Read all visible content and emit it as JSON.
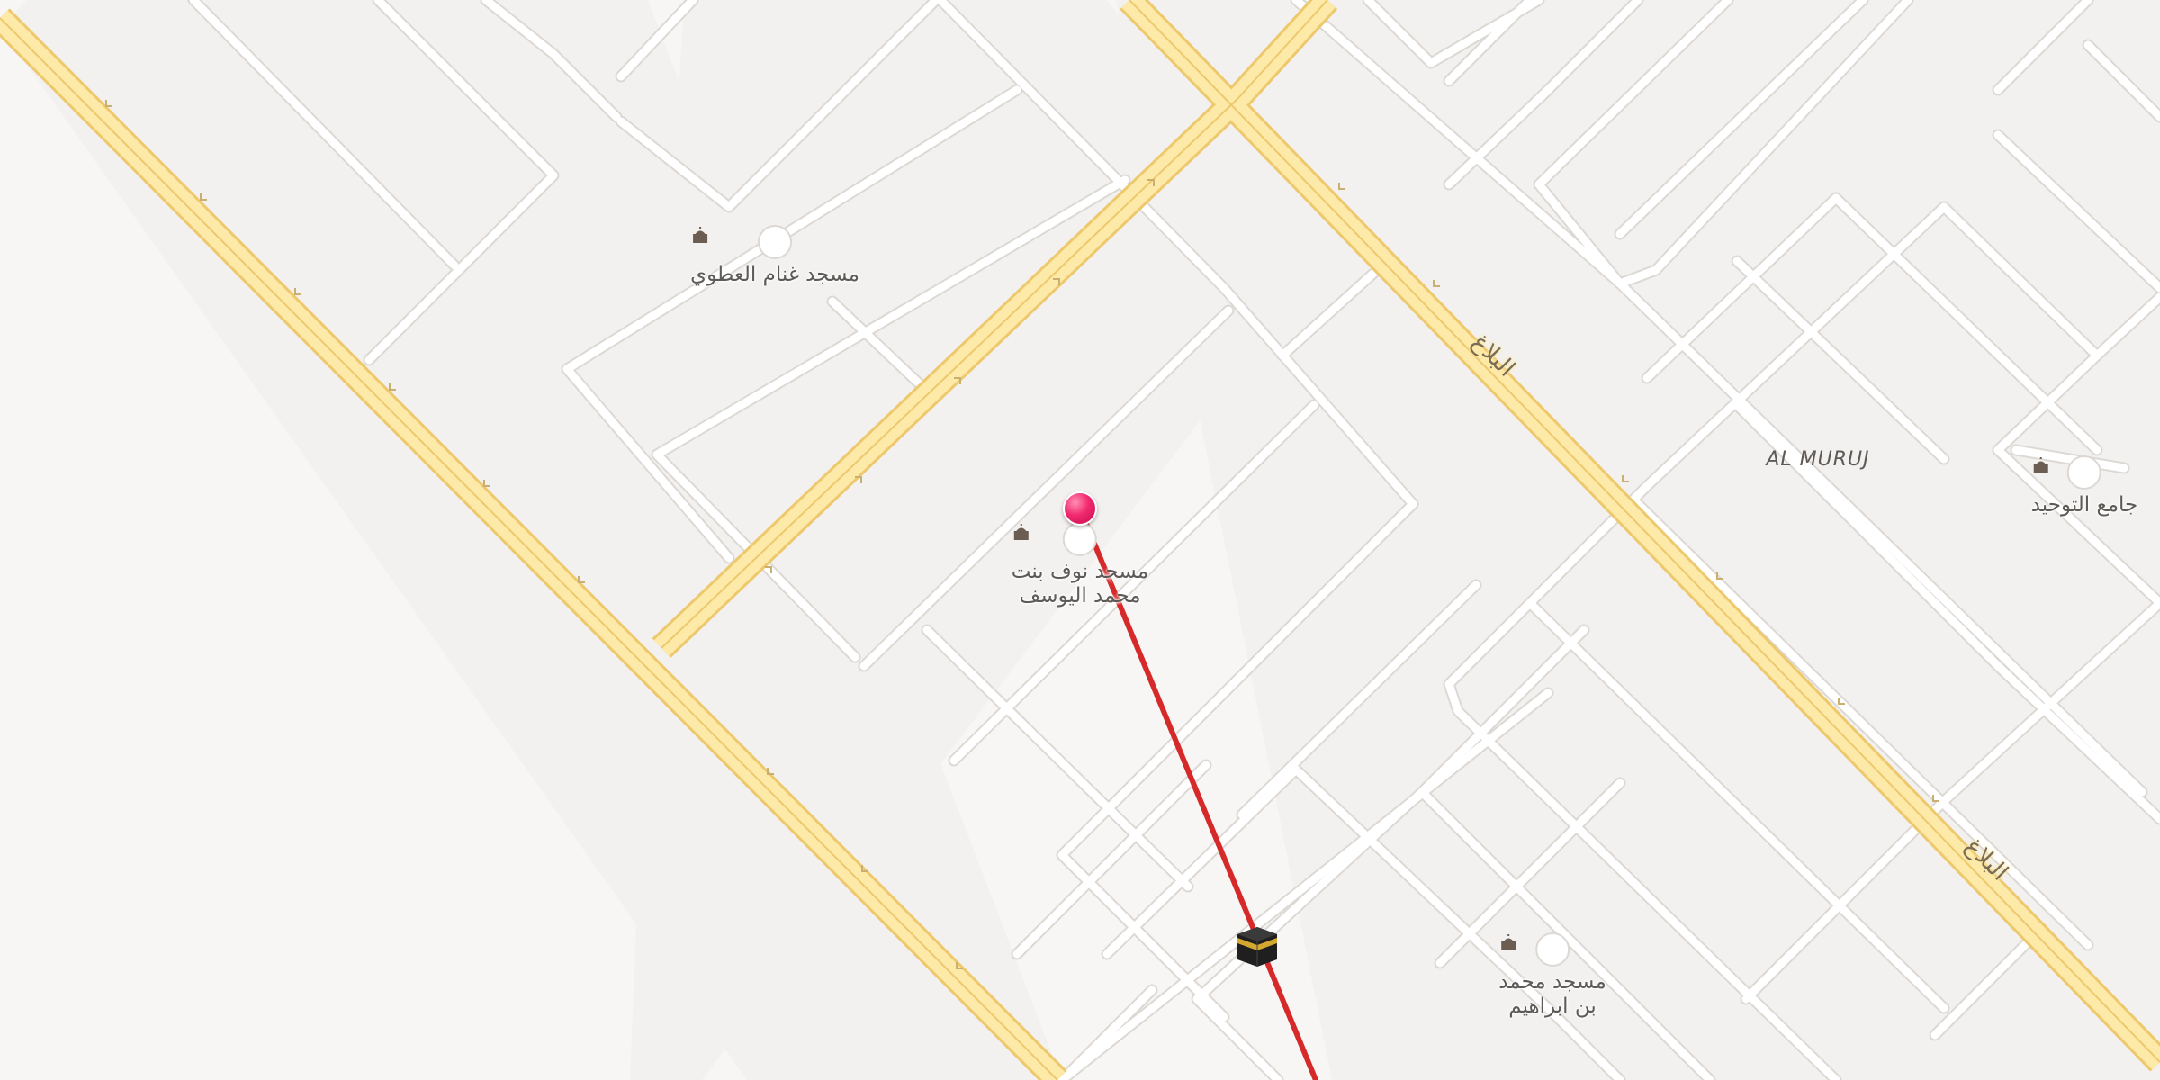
{
  "area_label": "AL MURUJ",
  "road_labels": [
    "البلاغ",
    "البلاغ"
  ],
  "pois": [
    {
      "id": "ghannam",
      "name_lines": [
        "مسجد غنام العطوي"
      ],
      "icon": "mosque-icon"
    },
    {
      "id": "nouf",
      "name_lines": [
        "مسجد نوف بنت",
        "محمد اليوسف"
      ],
      "icon": "mosque-icon"
    },
    {
      "id": "tawheed",
      "name_lines": [
        "جامع التوحيد"
      ],
      "icon": "mosque-icon"
    },
    {
      "id": "muhammad",
      "name_lines": [
        "مسجد محمد",
        "بن ابراهيم"
      ],
      "icon": "mosque-icon"
    }
  ],
  "markers": {
    "location_pin": {
      "icon": "location-pin-icon",
      "color": "#f2296e"
    },
    "qibla_target": {
      "icon": "kaaba-icon"
    }
  },
  "qibla_line": {
    "color": "#d62a2a"
  },
  "colors": {
    "land": "#f3f1ef",
    "street": "#ffffff",
    "street_casing": "#dcd8d4",
    "arterial": "#fde9a8",
    "arterial_casing": "#eec86c"
  }
}
